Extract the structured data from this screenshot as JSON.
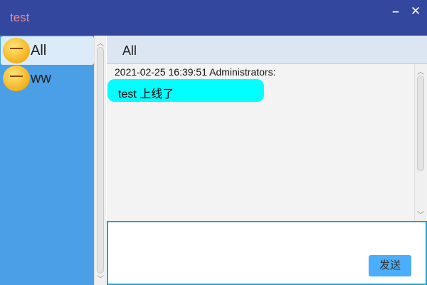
{
  "window": {
    "title": "test",
    "minimize_icon": "minus",
    "close_icon": "x"
  },
  "contacts": [
    {
      "name": "All",
      "avatar": "waving-emoji",
      "selected": true
    },
    {
      "name": "ww",
      "avatar": "sleepy-emoji",
      "selected": false
    }
  ],
  "chat": {
    "name": "All",
    "messages": [
      {
        "meta": "2021-02-25 16:39:51 Administrators:",
        "text": "test 上线了"
      }
    ]
  },
  "composer": {
    "value": "",
    "send_label": "发送"
  },
  "colors": {
    "titlebar": "#33479f",
    "list": "#4a9fe6",
    "bubble": "#00ffff",
    "send": "#4aaefc"
  }
}
